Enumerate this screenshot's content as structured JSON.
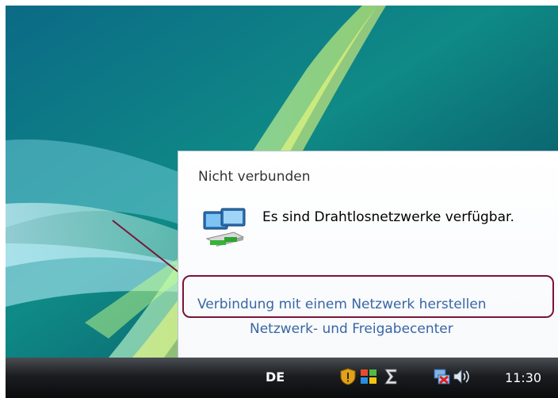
{
  "popup": {
    "title": "Nicht verbunden",
    "message": "Es sind Drahtlosnetzwerke verfügbar.",
    "connect_link": "Verbindung mit einem Netzwerk herstellen",
    "network_center_link": "Netzwerk- und Freigabecenter",
    "icon": "network-computers-icon"
  },
  "taskbar": {
    "language": "DE",
    "clock": "11:30",
    "tray_icons": [
      "security-shield-icon",
      "windows-flag-icon",
      "sigma-icon",
      "network-disconnected-icon",
      "speaker-icon"
    ]
  },
  "colors": {
    "link": "#3966a5",
    "callout": "#7a1438",
    "taskbar": "#1b1d20"
  }
}
